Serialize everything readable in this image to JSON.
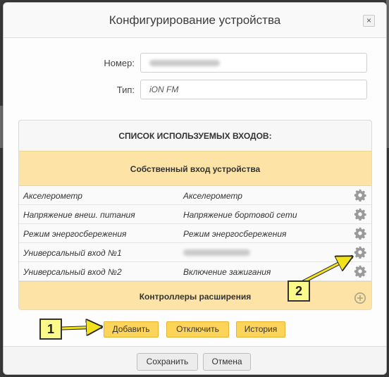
{
  "dialog": {
    "title": "Конфигурирование устройства",
    "close_label": "×"
  },
  "form": {
    "number_label": "Номер:",
    "number_value": "",
    "type_label": "Тип:",
    "type_value": "iON FM"
  },
  "inputs": {
    "title": "СПИСОК ИСПОЛЬЗУЕМЫХ ВХОДОВ:",
    "own_section": "Собственный вход устройства",
    "rows": [
      {
        "input": "Акселерометр",
        "assigned": "Акселерометр"
      },
      {
        "input": "Напряжение внеш. питания",
        "assigned": "Напряжение бортовой сети"
      },
      {
        "input": "Режим энергосбережения",
        "assigned": "Режим энергосбережения"
      },
      {
        "input": "Универсальный вход №1",
        "assigned": ""
      },
      {
        "input": "Универсальный вход №2",
        "assigned": "Включение зажигания"
      }
    ],
    "expansion_section": "Контроллеры расширения"
  },
  "actions": {
    "add": "Добавить",
    "disable": "Отключить",
    "history": "История"
  },
  "footer": {
    "save": "Сохранить",
    "cancel": "Отмена"
  },
  "annotations": {
    "badge_1": "1",
    "badge_2": "2"
  },
  "colors": {
    "accent_yellow": "#fdd45a",
    "section_band": "#fde4a6",
    "callout_fill": "#fbfa8b",
    "arrow": "#f2e21c"
  },
  "icons": {
    "row_action": "gear-icon",
    "add_controller": "plus-circle-icon",
    "close": "close-icon"
  }
}
